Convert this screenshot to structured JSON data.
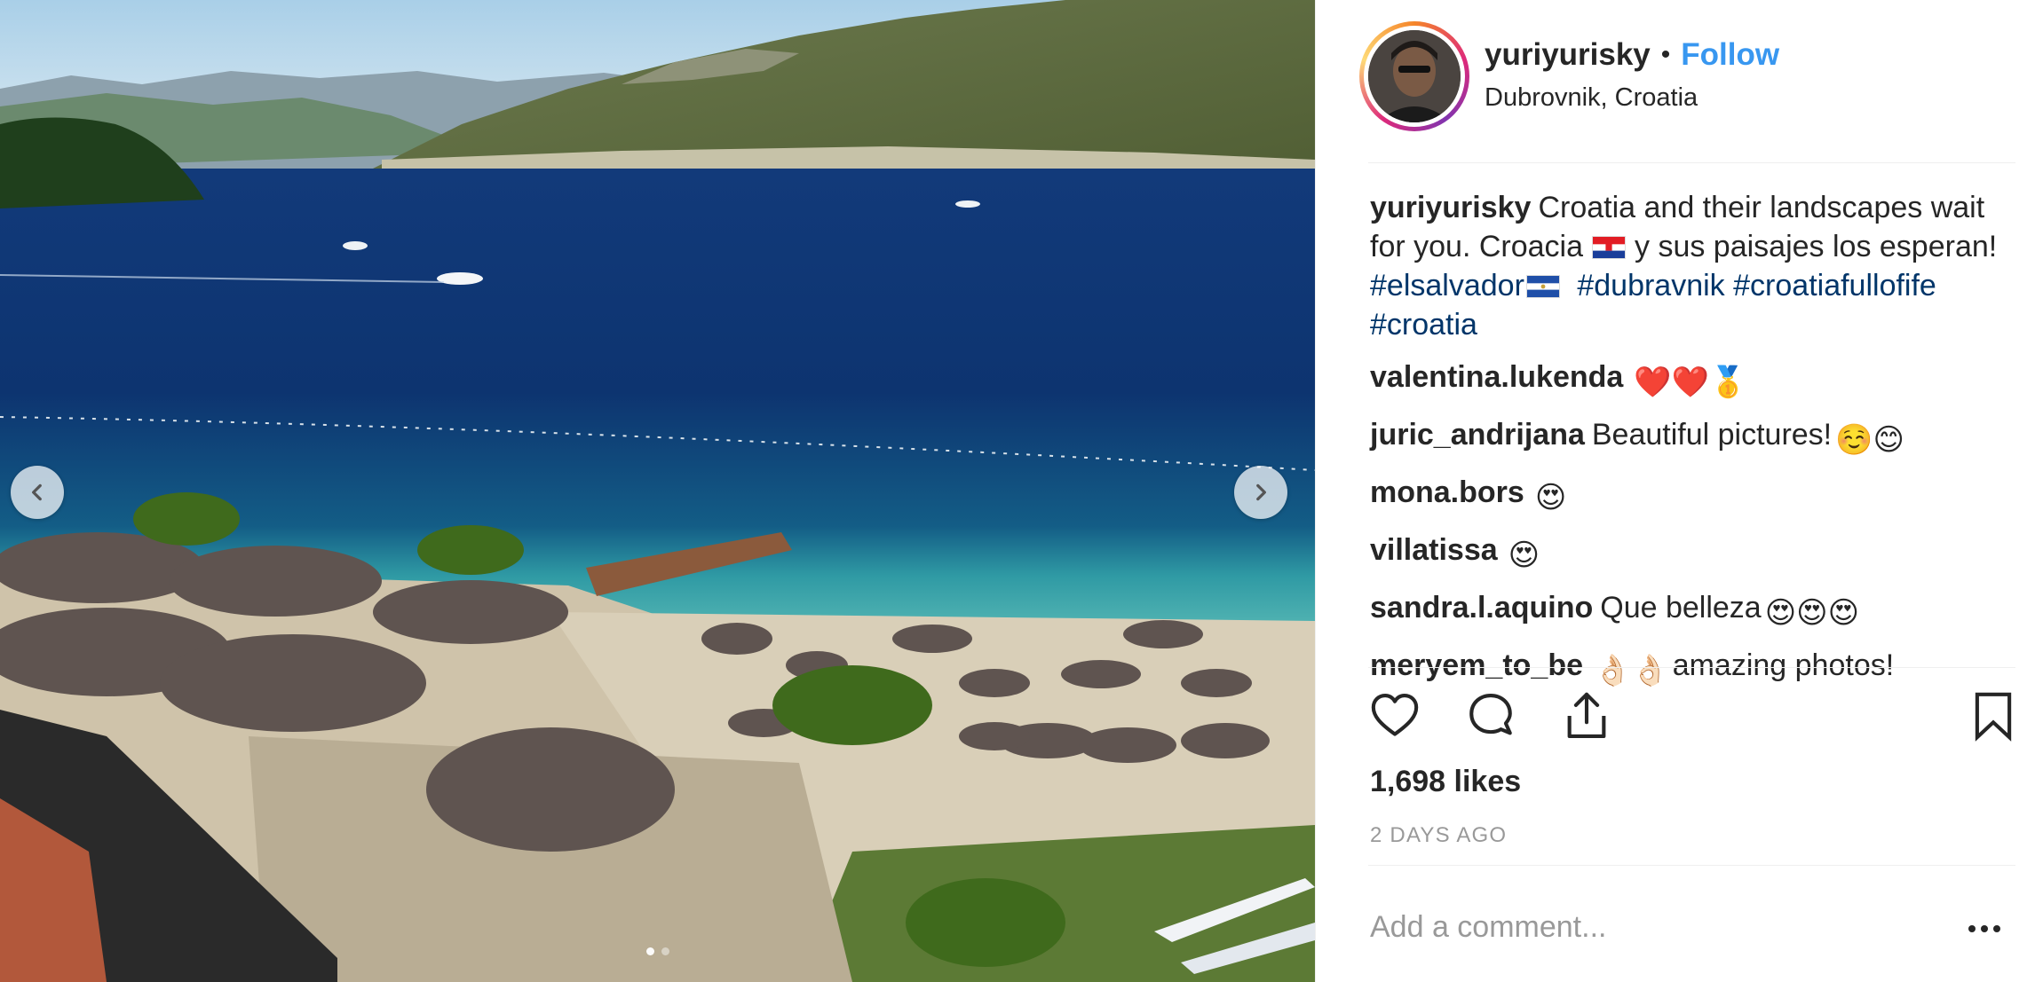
{
  "post": {
    "username": "yuriyurisky",
    "bullet": "•",
    "follow_label": "Follow",
    "location": "Dubrovnik, Croatia",
    "caption": {
      "user": "yuriyurisky",
      "text_1": "Croatia and their landscapes wait for you. Croacia",
      "text_2": "y sus paisajes los esperan!",
      "hashtags": [
        "#elsalvador",
        "#dubravnik",
        "#croatiafullofife",
        "#croatia"
      ]
    },
    "comments": [
      {
        "user": "valentina.lukenda",
        "text": "",
        "emoji": "❤️❤️🥇"
      },
      {
        "user": "juric_andrijana",
        "text": "Beautiful pictures!",
        "emoji": "☺️😊"
      },
      {
        "user": "mona.bors",
        "text": "",
        "emoji": "😍"
      },
      {
        "user": "villatissa",
        "text": "",
        "emoji": "😍"
      },
      {
        "user": "sandra.l.aquino",
        "text": "Que belleza",
        "emoji": "😍😍😍"
      },
      {
        "user": "meryem_to_be",
        "text": "amazing photos!",
        "emoji": "👌🏻👌🏻"
      }
    ],
    "likes": "1,698 likes",
    "time": "2 DAYS AGO",
    "comment_placeholder": "Add a comment...",
    "carousel": {
      "current_index": 1,
      "total": 2
    }
  },
  "icons": {
    "like": "heart-icon",
    "comment": "comment-bubble-icon",
    "share": "share-icon",
    "save": "bookmark-icon",
    "prev": "chevron-left-icon",
    "next": "chevron-right-icon",
    "more": "more-dots-icon"
  },
  "colors": {
    "follow": "#3897f0",
    "hashtag": "#003569",
    "timestamp": "#999999",
    "text": "#262626"
  }
}
